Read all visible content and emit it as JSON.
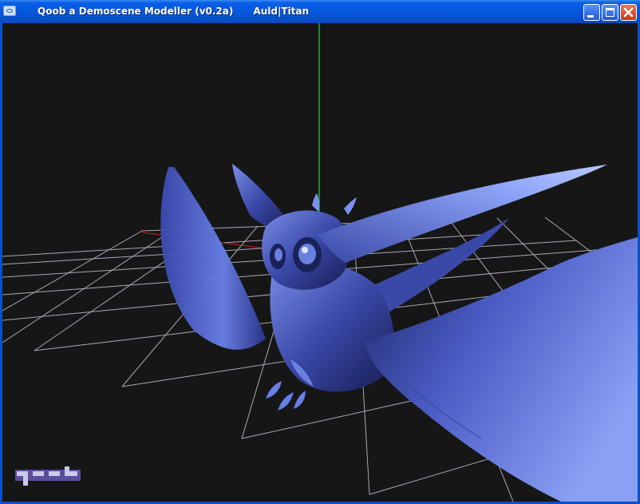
{
  "window": {
    "title": "Qoob a Demoscene Modeller (v0.2a)      Auld|Titan",
    "controls": [
      "minimize",
      "maximize",
      "close"
    ],
    "icon": "app-icon"
  },
  "viewport": {
    "background": "#161616",
    "grid_color": "#b8b8c8",
    "y_axis_color": "#2ecc40",
    "x_axis_color": "#d02020",
    "model_color": "#5566c4",
    "model": "winged-creature",
    "logo": "qoob"
  },
  "colors": {
    "titlebar": "#0655d8",
    "frame": "#0a50c8"
  }
}
